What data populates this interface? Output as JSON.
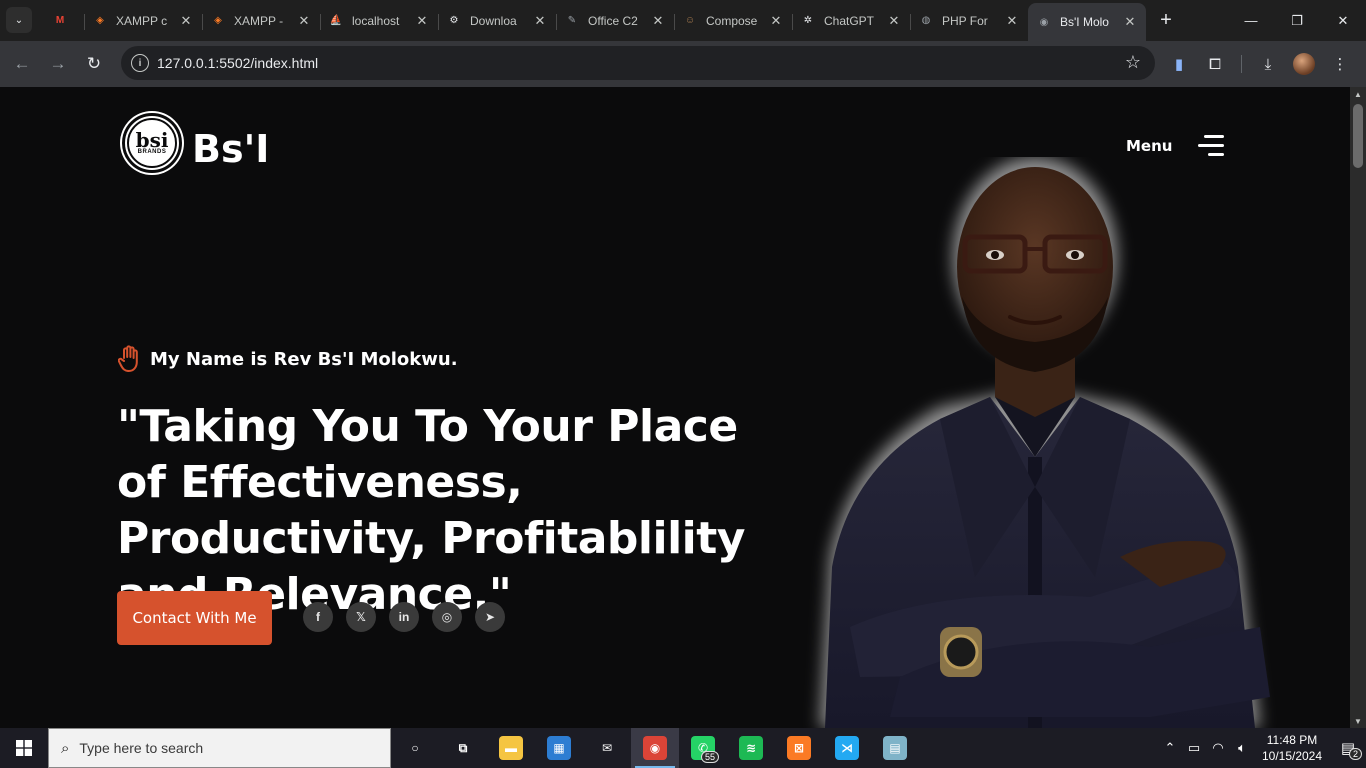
{
  "browser": {
    "tabs": [
      {
        "title": "",
        "icon": "gmail-icon",
        "color": "#ea4335",
        "glyph": "M"
      },
      {
        "title": "XAMPP c",
        "icon": "xampp-icon",
        "color": "#fb7a24",
        "glyph": "◈"
      },
      {
        "title": "XAMPP -",
        "icon": "xampp-icon",
        "color": "#fb7a24",
        "glyph": "◈"
      },
      {
        "title": "localhost",
        "icon": "phpmyadmin-icon",
        "color": "#f29111",
        "glyph": "⛵"
      },
      {
        "title": "Downloa",
        "icon": "gear-icon",
        "color": "#e8eaed",
        "glyph": "⚙"
      },
      {
        "title": "Office C2",
        "icon": "document-icon",
        "color": "#9aa0a6",
        "glyph": "✎"
      },
      {
        "title": "Compose",
        "icon": "composer-icon",
        "color": "#a77b4f",
        "glyph": "☺"
      },
      {
        "title": "ChatGPT",
        "icon": "chatgpt-icon",
        "color": "#e8eaed",
        "glyph": "✲"
      },
      {
        "title": "PHP For",
        "icon": "globe-icon",
        "color": "#9aa0a6",
        "glyph": "◍"
      },
      {
        "title": "Bs'I Molo",
        "icon": "eye-icon",
        "color": "#9aa0a6",
        "glyph": "◉",
        "active": true
      }
    ],
    "url": "127.0.0.1:5502/index.html"
  },
  "site": {
    "brand": "Bs'I",
    "logo_big": "bsi",
    "logo_small": "BRANDS",
    "menu_label": "Menu",
    "greeting": "My Name is Rev Bs'I Molokwu.",
    "headline": "\"Taking You To Your Place of Effectiveness, Productivity, Profitablility and Relevance.\"",
    "cta_label": "Contact With Me",
    "accent_color": "#d6522d",
    "socials": [
      {
        "icon": "facebook-icon",
        "glyph": "f"
      },
      {
        "icon": "x-twitter-icon",
        "glyph": "𝕏"
      },
      {
        "icon": "linkedin-icon",
        "glyph": "in"
      },
      {
        "icon": "instagram-icon",
        "glyph": "◎"
      },
      {
        "icon": "telegram-icon",
        "glyph": "➤"
      }
    ]
  },
  "taskbar": {
    "search_placeholder": "Type here to search",
    "apps": [
      {
        "icon": "cortana-icon",
        "glyph": "○",
        "color": "transparent"
      },
      {
        "icon": "task-view-icon",
        "glyph": "⧉",
        "color": "transparent"
      },
      {
        "icon": "file-explorer-icon",
        "glyph": "▬",
        "color": "#f5c542"
      },
      {
        "icon": "microsoft-store-icon",
        "glyph": "▦",
        "color": "#2d7dd2"
      },
      {
        "icon": "mail-icon",
        "glyph": "✉",
        "color": "transparent"
      },
      {
        "icon": "chrome-icon",
        "glyph": "◉",
        "color": "#db4437",
        "active": true
      },
      {
        "icon": "whatsapp-icon",
        "glyph": "✆",
        "color": "#25d366",
        "badge": "55"
      },
      {
        "icon": "spotify-icon",
        "glyph": "≋",
        "color": "#1db954"
      },
      {
        "icon": "xampp-icon",
        "glyph": "⊠",
        "color": "#fb7a24"
      },
      {
        "icon": "vscode-icon",
        "glyph": "⋊",
        "color": "#23a9f2"
      },
      {
        "icon": "notepad-icon",
        "glyph": "▤",
        "color": "#7fb3c8"
      }
    ],
    "time": "11:48 PM",
    "date": "10/15/2024",
    "notification_count": "2"
  }
}
